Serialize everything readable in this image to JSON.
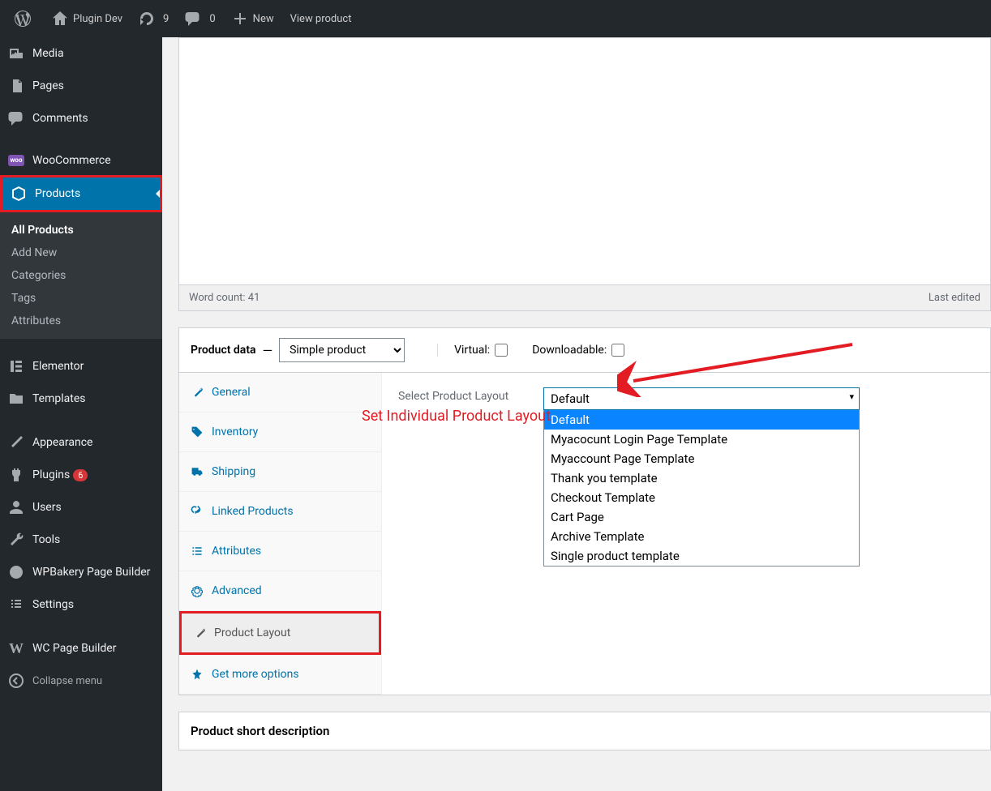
{
  "admin_bar": {
    "site_name": "Plugin Dev",
    "updates": "9",
    "comments": "0",
    "new": "New",
    "view_product": "View product"
  },
  "sidebar": {
    "media": "Media",
    "pages": "Pages",
    "comments": "Comments",
    "woocommerce": "WooCommerce",
    "products": "Products",
    "submenu": {
      "all_products": "All Products",
      "add_new": "Add New",
      "categories": "Categories",
      "tags": "Tags",
      "attributes": "Attributes"
    },
    "elementor": "Elementor",
    "templates": "Templates",
    "appearance": "Appearance",
    "plugins": "Plugins",
    "plugins_badge": "6",
    "users": "Users",
    "tools": "Tools",
    "wpbakery": "WPBakery Page Builder",
    "settings": "Settings",
    "wc_page_builder": "WC Page Builder",
    "collapse": "Collapse menu"
  },
  "editor": {
    "word_count": "Word count: 41",
    "last_edited": "Last edited"
  },
  "product_data": {
    "title": "Product data",
    "dash": " — ",
    "type_select": "Simple product",
    "virtual": "Virtual:",
    "downloadable": "Downloadable:",
    "tabs": {
      "general": "General",
      "inventory": "Inventory",
      "shipping": "Shipping",
      "linked": "Linked Products",
      "attributes": "Attributes",
      "advanced": "Advanced",
      "product_layout": "Product Layout",
      "get_more": "Get more options"
    },
    "layout": {
      "label": "Select Product Layout",
      "selected": "Default",
      "options": [
        "Default",
        "Myacocunt Login Page Template",
        "Myaccount Page Template",
        "Thank you template",
        "Checkout Template",
        "Cart Page",
        "Archive Template",
        "Single product template"
      ],
      "annotation": "Set Individual Product Layout"
    }
  },
  "short_desc": {
    "title": "Product short description"
  }
}
